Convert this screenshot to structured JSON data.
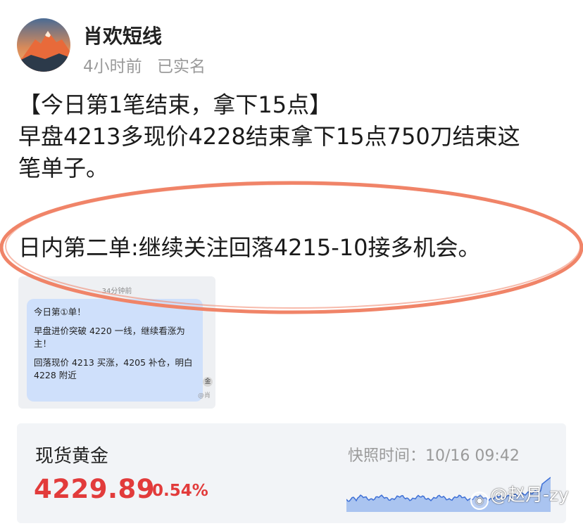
{
  "post": {
    "author": "肖欢短线",
    "time_ago": "4小时前",
    "verified_label": "已实名",
    "lines": [
      "【今日第1笔结束，拿下15点】",
      "早盘4213多现价4228结束拿下15点750刀结束这",
      "笔单子。",
      "日内第二单:继续关注回落4215-10接多机会。"
    ]
  },
  "quoted_image": {
    "time": "34分钟前",
    "paragraphs": [
      "今日第①单！",
      "早盘进价突破 4220 一线，继续看涨为主！",
      "回落现价 4213 买涨，4205 补仓，明白 4228 附近"
    ],
    "side_badge": "金",
    "side_tag": "@肖"
  },
  "quote": {
    "asset": "现货黄金",
    "price": "4229.89",
    "change": "0.54%",
    "snapshot_label": "快照时间：",
    "snapshot_time": "10/16  09:42",
    "colors": {
      "up": "#e23b3b",
      "line": "#3d6fd6",
      "fill": "#aac4f0"
    }
  },
  "annotation": {
    "color": "#f08468"
  },
  "watermark": {
    "handle": "@赵月-zy",
    "icon": "weibo-icon"
  }
}
